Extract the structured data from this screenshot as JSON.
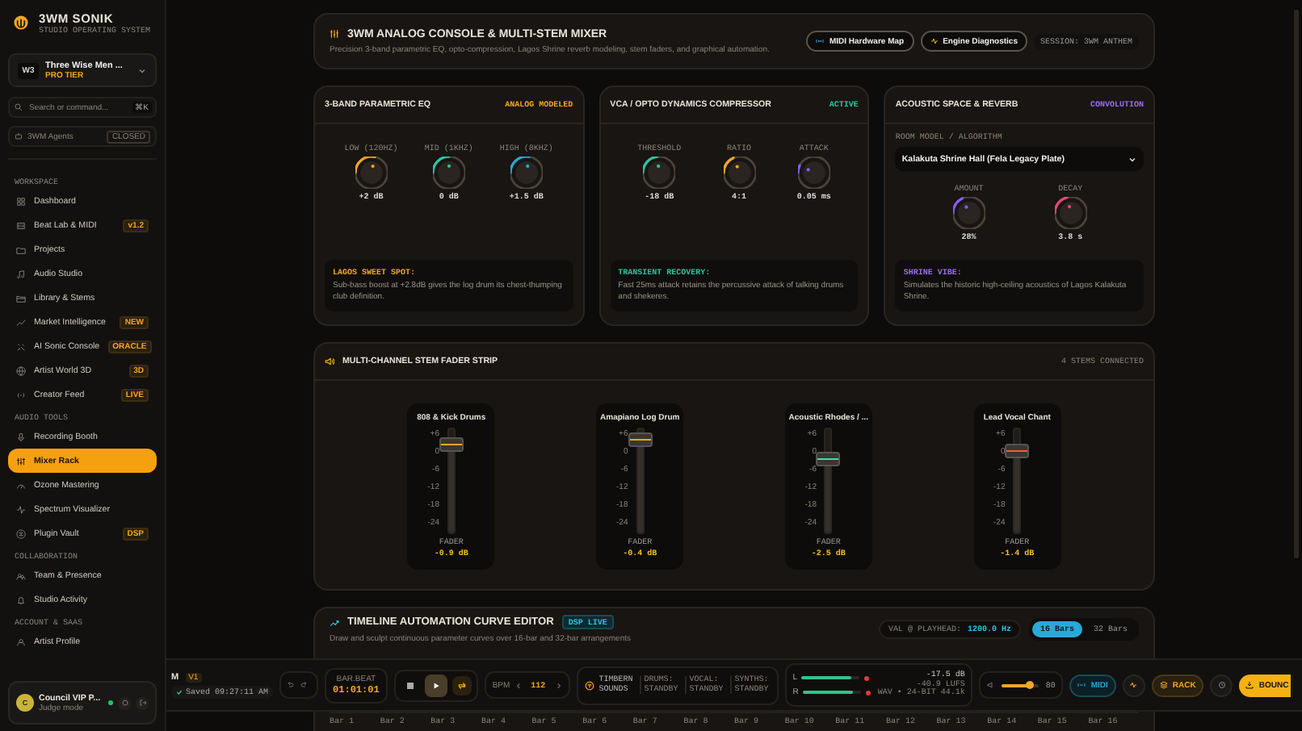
{
  "sidebar": {
    "logo": "3WM SONIK",
    "tagline": "STUDIO OPERATING SYSTEM",
    "project": {
      "initials": "W3",
      "name": "Three Wise Men ...",
      "tier": "PRO TIER"
    },
    "search": {
      "placeholder": "Search or command...",
      "shortcut": "⌘K"
    },
    "agents": {
      "label": "3WM Agents",
      "status": "CLOSED"
    },
    "sections": [
      {
        "title": "WORKSPACE",
        "items": [
          {
            "label": "Dashboard",
            "selected": false
          },
          {
            "label": "Beat Lab & MIDI",
            "badge": "v1.2",
            "selected": false
          },
          {
            "label": "Projects",
            "selected": false
          },
          {
            "label": "Audio Studio",
            "selected": false
          },
          {
            "label": "Library & Stems",
            "selected": false
          },
          {
            "label": "Market Intelligence",
            "badge": "NEW",
            "selected": false
          },
          {
            "label": "AI Sonic Console",
            "badge": "ORACLE",
            "selected": false
          },
          {
            "label": "Artist World 3D",
            "badge": "3D",
            "selected": false
          },
          {
            "label": "Creator Feed",
            "badge": "LIVE",
            "selected": false
          }
        ]
      },
      {
        "title": "AUDIO TOOLS",
        "items": [
          {
            "label": "Recording Booth",
            "selected": false
          },
          {
            "label": "Mixer Rack",
            "selected": true
          },
          {
            "label": "Ozone Mastering",
            "selected": false
          },
          {
            "label": "Spectrum Visualizer",
            "selected": false
          },
          {
            "label": "Plugin Vault",
            "badge": "DSP",
            "selected": false
          }
        ]
      },
      {
        "title": "COLLABORATION",
        "items": [
          {
            "label": "Team & Presence",
            "selected": false
          },
          {
            "label": "Studio Activity",
            "selected": false
          }
        ]
      },
      {
        "title": "ACCOUNT & SAAS",
        "items": [
          {
            "label": "Artist Profile",
            "selected": false
          }
        ]
      }
    ],
    "user": {
      "initial": "C",
      "name": "Council VIP P...",
      "subtitle": "Judge mode",
      "online": true
    }
  },
  "header": {
    "title": "3WM ANALOG CONSOLE & MULTI-STEM MIXER",
    "description": "Precision 3-band parametric EQ, opto-compression, Lagos Shrine reverb modeling, stem faders, and graphical automation.",
    "buttons": [
      "MIDI Hardware Map",
      "Engine Diagnostics"
    ],
    "session": "SESSION: 3WM ANTHEM"
  },
  "eq": {
    "title": "3-BAND PARAMETRIC EQ",
    "badge": "ANALOG MODELED",
    "knobs": [
      {
        "label": "LOW (120HZ)",
        "value": "+2 dB",
        "level": 0.6,
        "color": "#f5a623"
      },
      {
        "label": "MID (1KHZ)",
        "value": "0 dB",
        "level": 0.5,
        "color": "#2ec4a0"
      },
      {
        "label": "HIGH (8KHZ)",
        "value": "+1.5 dB",
        "level": 0.58,
        "color": "#2aa8d8"
      }
    ],
    "note_title": "LAGOS SWEET SPOT:",
    "note": "Sub-bass boost at +2.8dB gives the log drum its chest-thumping club definition."
  },
  "compressor": {
    "title": "VCA / OPTO DYNAMICS COMPRESSOR",
    "badge": "ACTIVE",
    "knobs": [
      {
        "label": "THRESHOLD",
        "value": "-18 dB",
        "level": 0.45,
        "color": "#2ec4a0"
      },
      {
        "label": "RATIO",
        "value": "4:1",
        "level": 0.3,
        "color": "#f5a623"
      },
      {
        "label": "ATTACK",
        "value": "0.05 ms",
        "level": 0.05,
        "color": "#8a5cf6"
      }
    ],
    "note_title": "TRANSIENT RECOVERY:",
    "note": "Fast 25ms attack retains the percussive attack of talking drums and shekeres."
  },
  "reverb": {
    "title": "ACOUSTIC SPACE & REVERB",
    "badge": "CONVOLUTION",
    "field_label": "ROOM MODEL / ALGORITHM",
    "room": "Kalakuta Shrine Hall (Fela Legacy Plate)",
    "knobs": [
      {
        "label": "AMOUNT",
        "value": "28%",
        "level": 0.28,
        "color": "#8a5cf6"
      },
      {
        "label": "DECAY",
        "value": "3.8 s",
        "level": 0.38,
        "color": "#e8457a"
      }
    ],
    "note_title": "SHRINE VIBE:",
    "note": "Simulates the historic high-ceiling acoustics of Lagos Kalakuta Shrine."
  },
  "fader_strip": {
    "title": "MULTI-CHANNEL STEM FADER STRIP",
    "status": "4 STEMS CONNECTED",
    "faders": [
      {
        "name": "808 & Kick Drums",
        "label": "FADER",
        "value": "-0.9 dB",
        "level": 0.92,
        "color": "#f5a623",
        "scale": [
          "+6",
          "0",
          "-6",
          "-12",
          "-18",
          "-24"
        ]
      },
      {
        "name": "Amapiano Log Drum",
        "label": "FADER",
        "value": "-0.4 dB",
        "level": 0.97,
        "color": "#f5a623",
        "scale": [
          "+6",
          "0",
          "-6",
          "-12",
          "-18",
          "-24"
        ]
      },
      {
        "name": "Acoustic Rhodes / ...",
        "label": "FADER",
        "value": "-2.5 dB",
        "level": 0.78,
        "color": "#2ee8a8",
        "scale": [
          "+6",
          "0",
          "-6",
          "-12",
          "-18",
          "-24"
        ]
      },
      {
        "name": "Lead Vocal Chant",
        "label": "FADER",
        "value": "-1.4 dB",
        "level": 0.86,
        "color": "#e8603a",
        "scale": [
          "+6",
          "0",
          "-6",
          "-12",
          "-18",
          "-24"
        ]
      }
    ]
  },
  "timeline": {
    "title": "TIMELINE AUTOMATION CURVE EDITOR",
    "badge": "DSP LIVE",
    "description": "Draw and sculpt continuous parameter curves over 16-bar and 32-bar arrangements",
    "playhead_label": "VAL @ PLAYHEAD:",
    "playhead_value": "1200.0 Hz",
    "tabs": [
      {
        "label": "16 Bars",
        "selected": true
      },
      {
        "label": "32 Bars",
        "selected": false
      }
    ],
    "ruler": [
      "Bar 1",
      "Bar 2",
      "Bar 3",
      "Bar 4",
      "Bar 5",
      "Bar 6",
      "Bar 7",
      "Bar 8",
      "Bar 9",
      "Bar 10",
      "Bar 11",
      "Bar 12",
      "Bar 13",
      "Bar 14",
      "Bar 15",
      "Bar 16"
    ]
  },
  "transport": {
    "mark": "M",
    "version": "V1",
    "saved": "Saved 09:27:11 AM",
    "time_label": "BAR.BEAT",
    "time": "01:01:01",
    "playing": true,
    "loop": true,
    "bpm_label": "BPM",
    "bpm": "112",
    "engine": "TIMBERN SOUNDS",
    "engines": [
      {
        "label": "DRUMS: STANDBY"
      },
      {
        "label": "VOCAL: STANDBY"
      },
      {
        "label": "SYNTHS: STANDBY"
      }
    ],
    "meters": [
      {
        "label": "L",
        "level": 0.85
      },
      {
        "label": "R",
        "level": 0.85
      }
    ],
    "peak": "-17.5 dB",
    "lufs": "-40.9 LUFS",
    "format": "WAV • 24-BIT",
    "rate": "44.1k",
    "volume": {
      "level": 0.75,
      "value": "80"
    },
    "midi": "MIDI",
    "rack": "RACK",
    "bounce": "BOUNC"
  }
}
